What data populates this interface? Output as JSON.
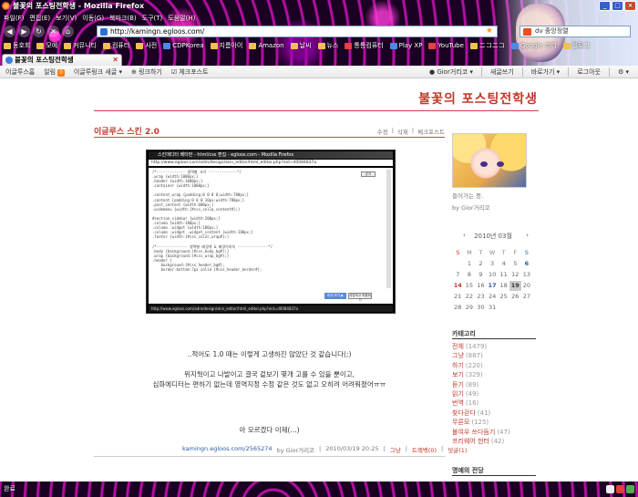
{
  "window": {
    "title": "불꽃의 포스팅전학생 - Mozilla Firefox",
    "controls": {
      "minimize": "_",
      "maximize": "□",
      "close": "×"
    }
  },
  "menu": [
    "파일(F)",
    "편집(E)",
    "보기(V)",
    "이동(G)",
    "북마크(B)",
    "도구(T)",
    "도움말(H)"
  ],
  "nav": {
    "url": "http://kamingn.egloos.com/",
    "search_value": "dv 중앙정렬"
  },
  "bookmarks": [
    "동호회",
    "모에",
    "커뮤니티",
    "컴퓨터",
    "사전",
    "CDPKorea",
    "지름아이",
    "Amazon",
    "날씨",
    "뉴스",
    "통통컴퓨터",
    "Play XP",
    "YouTube",
    "ニコニコ",
    "Google 리더",
    "블로그"
  ],
  "tab": {
    "label": "불꽃의 포스팅전학생"
  },
  "egloos_toolbar": {
    "left": [
      "이글루스홈",
      "알림",
      "이글루링크 새글",
      "링크하기",
      "체크포스트"
    ],
    "notify_count": "0",
    "right": [
      "Gior거리코",
      "새글쓰기",
      "바로가기",
      "로그아웃",
      "⚙"
    ]
  },
  "blog": {
    "title": "불꽃의 포스팅전학생"
  },
  "post": {
    "title": "이글루스 스킨 2.0",
    "actions": [
      "수정",
      "삭제",
      "체크포스트"
    ],
    "screenshot": {
      "window_title": "스킨에디터 베타판 - html/css 편집 - egloos.com - Mozilla Firefox",
      "url": "http://www.egloos.com/adm/design/skin_editor/html_editor.php?eid=d0084837a",
      "code": "/*------------- 영역별 크기 -------------*/\n.wrap {width:1000px;}\n.header {width:1000px;}\n.container {width:1000px;}\n\n.content_wrap {padding:0 0 0 0;width:780px;}\n.content {padding:0 0 0 10px;width:780px;}\n.post_content {width:600px;}\n.widemenu {width:{#css_col1a_content#};}\n\n#section_sidebar {width:200px;}\n.column {width:180px;}\n.column .widget {width:180px;}\n.column .widget .widget_content {width:180px;}\n.footer {width:{#css_col2c_wrap#};}\n\n/*-------------- 영역별 배경색 & 배경이미지 --------------*/\n.body {background:{#css_body_bg#};}\n.wrap {background:{#css_wrap_bg#};}\n.header {\n    background:{#css_header_bg#};\n    border-bottom:7px solid {#css_header_border#};",
      "btn_close": "닫기",
      "btn_save": "미리 보기 ▶",
      "btn_apply": "저장하고 적용하기",
      "status": "http://www.egloos.com/adm/design/skin_editor/html_editor.php?eid=d0084837a"
    },
    "paragraphs": [
      "..적어도 1.0 때는 이렇게 고생하진 않았단 것 같습니다(;)",
      "위지웍이고 나발이고 결국 겉보기 몇개 고를 수 있을 뿐이고,",
      "심화에디터는 편하기 없는데 영역지정 수정 같은 것도 없고 오히려 어려워졌어ㅠㅠ",
      "아 모르겠다 이제(...)"
    ],
    "footer": {
      "permalink": "kamingn.egloos.com/2565274",
      "by": "by Gior거리코",
      "date": "2010/03/19 20:25",
      "category": "그냥",
      "trackback": "트랙백(0)",
      "comments": "덧글(1)"
    }
  },
  "sidebar": {
    "profile_caption": "들어가는 중.",
    "profile_by": "by Gior거리코",
    "calendar": {
      "title": "2010년 03월",
      "prev": "‹",
      "next": "›",
      "dow": [
        "S",
        "M",
        "T",
        "W",
        "T",
        "F",
        "S"
      ],
      "days": [
        "",
        "1",
        "2",
        "3",
        "4",
        "5",
        "6",
        "7",
        "8",
        "9",
        "10",
        "11",
        "12",
        "13",
        "14",
        "15",
        "16",
        "17",
        "18",
        "19",
        "20",
        "21",
        "22",
        "23",
        "24",
        "25",
        "26",
        "27",
        "28",
        "29",
        "30",
        "31",
        "",
        "",
        ""
      ]
    },
    "categories_title": "카테고리",
    "categories": [
      {
        "name": "전체",
        "count": "(1479)"
      },
      {
        "name": "그냥",
        "count": "(887)"
      },
      {
        "name": "하기",
        "count": "(220)"
      },
      {
        "name": "보기",
        "count": "(329)"
      },
      {
        "name": "듣기",
        "count": "(89)"
      },
      {
        "name": "읽기",
        "count": "(49)"
      },
      {
        "name": "번역",
        "count": "(16)"
      },
      {
        "name": "찾다걷다",
        "count": "(41)"
      },
      {
        "name": "무른모",
        "count": "(125)"
      },
      {
        "name": "불여우 쓰다듬기",
        "count": "(47)"
      },
      {
        "name": "프리웨어 헌터",
        "count": "(42)"
      }
    ],
    "second_title": "명예의 전당"
  },
  "status": {
    "text": "완료"
  },
  "colors": {
    "accent": "#c0392b",
    "persona": "#b1109f"
  }
}
